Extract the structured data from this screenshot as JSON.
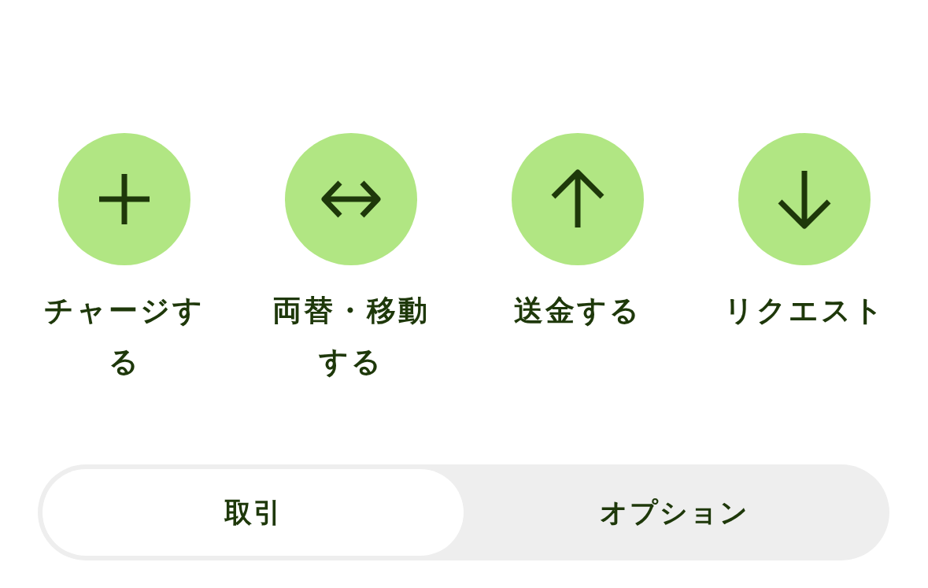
{
  "actions": [
    {
      "kind": "plus",
      "label": "チャージする"
    },
    {
      "kind": "exchange",
      "label": "両替・移動する"
    },
    {
      "kind": "up",
      "label": "送金する"
    },
    {
      "kind": "down",
      "label": "リクエスト"
    }
  ],
  "tabs": [
    {
      "label": "取引",
      "selected": true
    },
    {
      "label": "オプション",
      "selected": false
    }
  ]
}
